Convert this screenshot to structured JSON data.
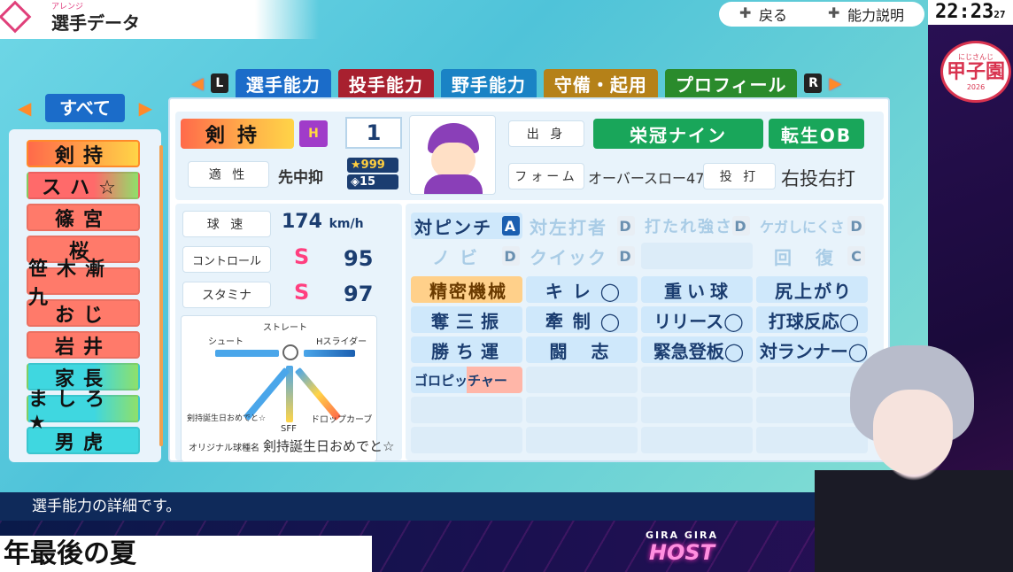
{
  "header": {
    "subtitle": "アレンジ",
    "title": "選手データ",
    "back_label": "戻る",
    "help_label": "能力説明",
    "clock": "22:23",
    "clock_seconds": "27",
    "logo_top": "にじさんじ",
    "logo_main": "甲子園",
    "logo_year": "2026"
  },
  "tabs": {
    "left_key": "L",
    "right_key": "R",
    "items": [
      "選手能力",
      "投手能力",
      "野手能力",
      "守備・起用",
      "プロフィール"
    ]
  },
  "list": {
    "filter_label": "すべて",
    "players": [
      {
        "name": "剣持",
        "color": "#ffb14a"
      },
      {
        "name": "スハ☆",
        "color": "#ff6a6a"
      },
      {
        "name": "篠宮",
        "color": "#ff6a6a"
      },
      {
        "name": "桜",
        "color": "#ff6a6a"
      },
      {
        "name": "笹木漸九",
        "color": "#ff6a6a"
      },
      {
        "name": "おじ",
        "color": "#ff6a6a"
      },
      {
        "name": "岩井",
        "color": "#ff6a6a"
      },
      {
        "name": "家長",
        "color": "#3fd7e0"
      },
      {
        "name": "ましろ★",
        "color": "#3fd7e0"
      },
      {
        "name": "男虎",
        "color": "#3fd7e0"
      }
    ]
  },
  "player": {
    "name": "剣持",
    "hand_badge": "H",
    "number": "1",
    "aptitude_label": "適 性",
    "aptitude_value": "先中抑",
    "star_value": "★999",
    "gem_value": "◈15",
    "origin_label": "出 身",
    "origin_value": "栄冠ナイン",
    "origin_tag": "転生OB",
    "form_label": "フォーム",
    "form_value": "オーバースロー47",
    "throw_label": "投 打",
    "throw_value": "右投右打"
  },
  "stats": {
    "speed_label": "球 速",
    "speed_value": "174",
    "speed_unit": "km/h",
    "control_label": "コントロール",
    "control_grade": "S",
    "control_value": "95",
    "stamina_label": "スタミナ",
    "stamina_grade": "S",
    "stamina_value": "97"
  },
  "pitches": {
    "straight": "ストレート",
    "shoot": "シュート",
    "h_slider": "Hスライダー",
    "sff": "SFF",
    "drop_curve": "ドロップカーブ",
    "original_left": "剣持誕生日おめでと☆",
    "original_label": "オリジナル球種名",
    "original_name": "剣持誕生日おめでと☆"
  },
  "abilities": {
    "row1": [
      {
        "label": "対ピンチ",
        "rank": "A",
        "dim": false
      },
      {
        "label": "対左打者",
        "rank": "D",
        "dim": true
      },
      {
        "label": "打たれ強さ",
        "rank": "D",
        "dim": true
      },
      {
        "label": "ケガしにくさ",
        "rank": "D",
        "dim": true
      }
    ],
    "row2": [
      {
        "label": "ノ ビ",
        "rank": "D",
        "dim": true
      },
      {
        "label": "クイック",
        "rank": "D",
        "dim": true
      },
      {
        "label": "",
        "rank": "",
        "dim": true
      },
      {
        "label": "回 復",
        "rank": "C",
        "dim": true
      }
    ],
    "row3": [
      "精密機械",
      "キ レ ◯",
      "重い球",
      "尻上がり"
    ],
    "row4": [
      "奪三振",
      "牽 制 ◯",
      "リリース◯",
      "打球反応◯"
    ],
    "row5": [
      "勝ち運",
      "闘 志",
      "緊急登板◯",
      "対ランナー◯"
    ],
    "row6": [
      "ゴロピッチャー"
    ]
  },
  "footer": {
    "help_text": "選手能力の詳細です。",
    "ticker": "年最後の夏",
    "brand_small": "GIRA GIRA",
    "brand_large": "HOST"
  },
  "colors": {
    "accent_blue": "#1b6cc9",
    "grade_pink": "#ff3f7f",
    "origin_green": "#19a65a"
  }
}
